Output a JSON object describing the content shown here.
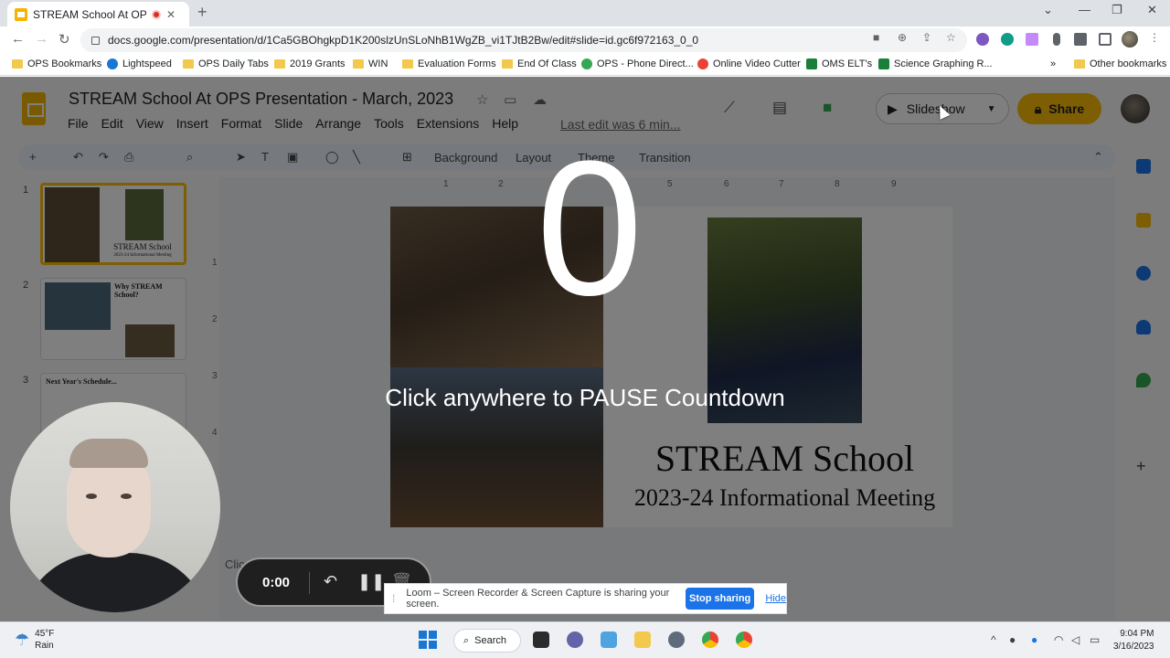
{
  "browser": {
    "tab_title": "STREAM School At OPS Prese",
    "url": "docs.google.com/presentation/d/1Ca5GBOhgkpD1K200slzUnSLoNhB1WgZB_vi1TJtB2Bw/edit#slide=id.gc6f972163_0_0",
    "bookmarks": [
      "OPS Bookmarks",
      "Lightspeed",
      "OPS Daily Tabs",
      "2019 Grants",
      "WIN",
      "Evaluation Forms",
      "End Of Class",
      "OPS - Phone Direct...",
      "Online Video Cutter",
      "OMS ELT's",
      "Science Graphing R...",
      "Other bookmarks"
    ],
    "more_bookmarks": "»"
  },
  "slides_app": {
    "title": "STREAM School At OPS Presentation - March, 2023",
    "menu": [
      "File",
      "Edit",
      "View",
      "Insert",
      "Format",
      "Slide",
      "Arrange",
      "Tools",
      "Extensions",
      "Help"
    ],
    "last_edit": "Last edit was 6 min...",
    "slideshow_label": "Slideshow",
    "share_label": "Share",
    "toolbar": {
      "background": "Background",
      "layout": "Layout",
      "theme": "Theme",
      "transition": "Transition"
    },
    "ruler_h": [
      "1",
      "2",
      "5",
      "6",
      "7",
      "8",
      "9"
    ],
    "ruler_v": [
      "1",
      "2",
      "3",
      "4"
    ],
    "slide_numbers": [
      "1",
      "2",
      "3"
    ],
    "thumb_texts": {
      "t1": "STREAM School",
      "t1_sub": "2023-24 Informational Meeting",
      "t2": "Why STREAM School?",
      "t3": "Next Year's Schedule..."
    },
    "slide": {
      "title": "STREAM School",
      "subtitle": "2023-24 Informational Meeting"
    },
    "speaker_notes": "Clic"
  },
  "loom": {
    "countdown": "0",
    "countdown_text": "Click anywhere to PAUSE Countdown",
    "timer": "0:00",
    "banner_text": "Loom – Screen Recorder & Screen Capture is sharing your screen.",
    "stop_sharing": "Stop sharing",
    "hide": "Hide"
  },
  "taskbar": {
    "weather_temp": "45°F",
    "weather_desc": "Rain",
    "search_label": "Search",
    "time": "9:04 PM",
    "date": "3/16/2023"
  },
  "colors": {
    "share_button": "#fbbc04",
    "stop_button": "#1a73e8",
    "record_dot": "#d93025"
  }
}
